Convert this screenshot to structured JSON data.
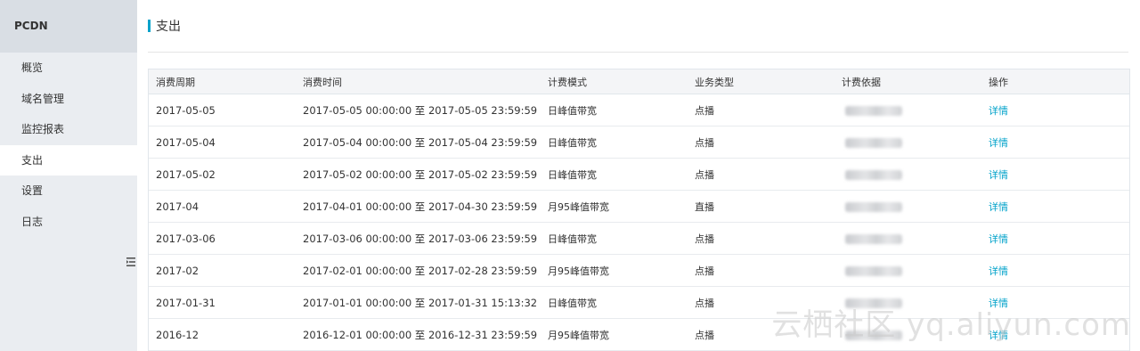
{
  "sidebar": {
    "title": "PCDN",
    "items": [
      {
        "label": "概览"
      },
      {
        "label": "域名管理"
      },
      {
        "label": "监控报表"
      },
      {
        "label": "支出"
      },
      {
        "label": "设置"
      },
      {
        "label": "日志"
      }
    ],
    "active_index": 3
  },
  "page": {
    "title": "支出"
  },
  "table": {
    "headers": [
      "消费周期",
      "消费时间",
      "计费模式",
      "业务类型",
      "计费依据",
      "操作"
    ],
    "rows": [
      {
        "period": "2017-05-05",
        "time": "2017-05-05 00:00:00 至 2017-05-05 23:59:59",
        "mode": "日峰值带宽",
        "type": "点播",
        "action": "详情"
      },
      {
        "period": "2017-05-04",
        "time": "2017-05-04 00:00:00 至 2017-05-04 23:59:59",
        "mode": "日峰值带宽",
        "type": "点播",
        "action": "详情"
      },
      {
        "period": "2017-05-02",
        "time": "2017-05-02 00:00:00 至 2017-05-02 23:59:59",
        "mode": "日峰值带宽",
        "type": "点播",
        "action": "详情"
      },
      {
        "period": "2017-04",
        "time": "2017-04-01 00:00:00 至 2017-04-30 23:59:59",
        "mode": "月95峰值带宽",
        "type": "直播",
        "action": "详情"
      },
      {
        "period": "2017-03-06",
        "time": "2017-03-06 00:00:00 至 2017-03-06 23:59:59",
        "mode": "日峰值带宽",
        "type": "点播",
        "action": "详情"
      },
      {
        "period": "2017-02",
        "time": "2017-02-01 00:00:00 至 2017-02-28 23:59:59",
        "mode": "月95峰值带宽",
        "type": "点播",
        "action": "详情"
      },
      {
        "period": "2017-01-31",
        "time": "2017-01-01 00:00:00 至 2017-01-31 15:13:32",
        "mode": "日峰值带宽",
        "type": "点播",
        "action": "详情"
      },
      {
        "period": "2016-12",
        "time": "2016-12-01 00:00:00 至 2016-12-31 23:59:59",
        "mode": "月95峰值带宽",
        "type": "点播",
        "action": "详情"
      }
    ]
  },
  "watermark": "云栖社区 yq.aliyun.com",
  "colors": {
    "accent": "#00a2ca",
    "sidebar_bg": "#eaedf1",
    "sidebar_header_bg": "#d9dee4",
    "table_header_bg": "#f4f5f7"
  },
  "icons": {
    "collapse": "collapse-menu-icon"
  }
}
